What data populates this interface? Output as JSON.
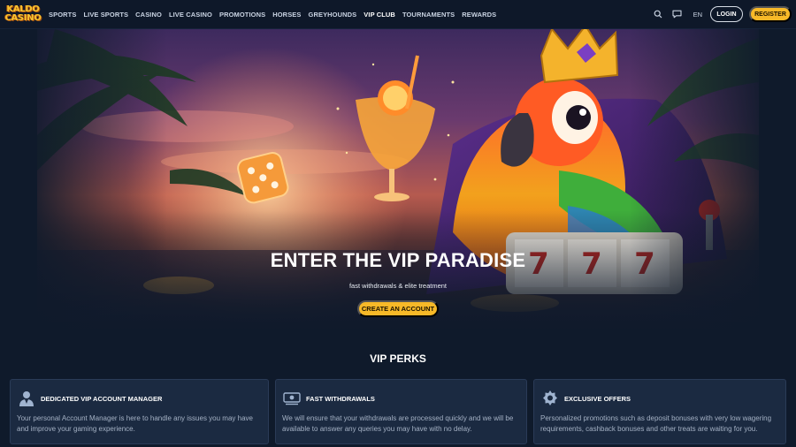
{
  "brand": {
    "logo_line1": "KALDO",
    "logo_line2": "CASINO"
  },
  "nav": {
    "items": [
      {
        "label": "SPORTS",
        "active": false
      },
      {
        "label": "LIVE SPORTS",
        "active": false
      },
      {
        "label": "CASINO",
        "active": false
      },
      {
        "label": "LIVE CASINO",
        "active": false
      },
      {
        "label": "PROMOTIONS",
        "active": false
      },
      {
        "label": "HORSES",
        "active": false
      },
      {
        "label": "GREYHOUNDS",
        "active": false
      },
      {
        "label": "VIP CLUB",
        "active": true
      },
      {
        "label": "TOURNAMENTS",
        "active": false
      },
      {
        "label": "REWARDS",
        "active": false
      }
    ]
  },
  "header": {
    "search_icon": "search-icon",
    "chat_icon": "chat-icon",
    "language": "EN",
    "login_label": "LOGIN",
    "register_label": "REGISTER"
  },
  "hero": {
    "title": "ENTER THE VIP PARADISE",
    "subtitle": "fast withdrawals & elite treatment",
    "cta_label": "CREATE AN ACCOUNT"
  },
  "perks": {
    "heading": "VIP PERKS",
    "cards": [
      {
        "icon": "account-manager-icon",
        "title": "DEDICATED VIP ACCOUNT MANAGER",
        "text": "Your personal Account Manager is here to handle any issues you may have and improve your gaming experience."
      },
      {
        "icon": "fast-withdrawal-icon",
        "title": "FAST WITHDRAWALS",
        "text": "We will ensure that your withdrawals are processed quickly and we will be available to answer any queries you may have with no delay."
      },
      {
        "icon": "exclusive-offers-icon",
        "title": "EXCLUSIVE OFFERS",
        "text": "Personalized promotions such as deposit bonuses with very low wagering requirements, cashback bonuses and other treats are waiting for you."
      }
    ]
  },
  "colors": {
    "background": "#0f1a2b",
    "header": "#0e1829",
    "accent": "#f7b928",
    "card": "#1b2a41",
    "muted_text": "#a4b1c4"
  }
}
